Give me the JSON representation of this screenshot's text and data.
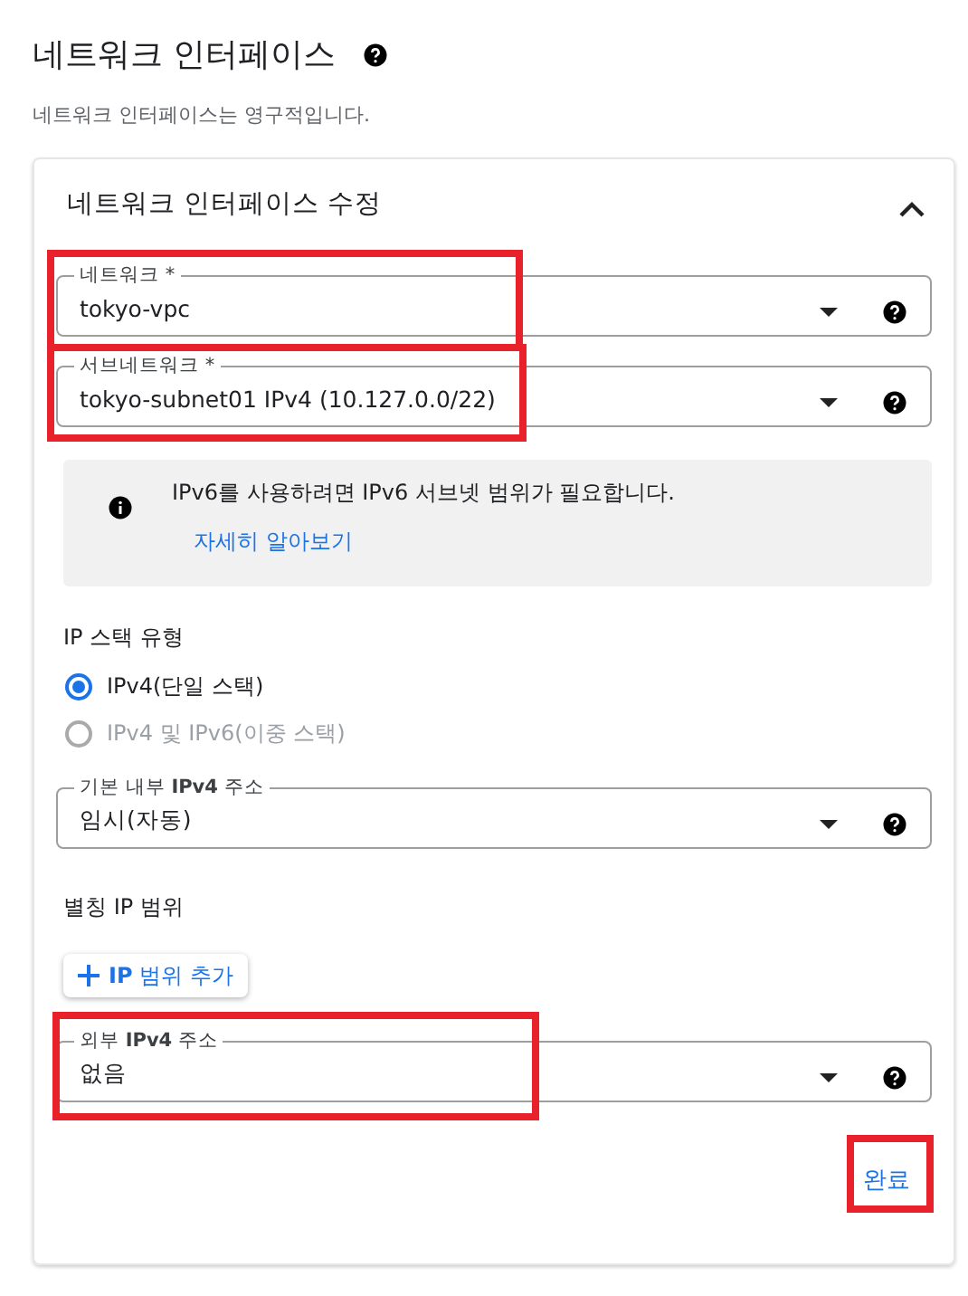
{
  "page": {
    "title": "네트워크 인터페이스",
    "subtitle": "네트워크 인터페이스는 영구적입니다."
  },
  "card": {
    "title": "네트워크 인터페이스 수정",
    "expanded": true
  },
  "fields_top": [
    {
      "label": "네트워크 *",
      "value": "tokyo-vpc",
      "highlighted": true
    },
    {
      "label": "서브네트워크 *",
      "value": "tokyo-subnet01 IPv4 (10.127.0.0/22)",
      "highlighted": true
    }
  ],
  "notice": {
    "text": "IPv6를 사용하려면 IPv6 서브넷 범위가 필요합니다.",
    "link": "자세히 알아보기"
  },
  "stack": {
    "title": "IP 스택 유형",
    "options": [
      {
        "label": "IPv4(단일 스택)",
        "selected": true,
        "disabled": false
      },
      {
        "label": "IPv4 및 IPv6(이중 스택)",
        "selected": false,
        "disabled": true
      }
    ]
  },
  "internal_field": {
    "label": "기본 내부 **IPv4** 주소",
    "value": "임시(자동)"
  },
  "alias": {
    "title": "별칭 IP 범위",
    "button": "**IP** 범위 추가"
  },
  "external_field": {
    "label": "외부 **IPv4** 주소",
    "value": "없음",
    "highlighted": true
  },
  "done": {
    "label": "완료",
    "highlighted": true
  }
}
